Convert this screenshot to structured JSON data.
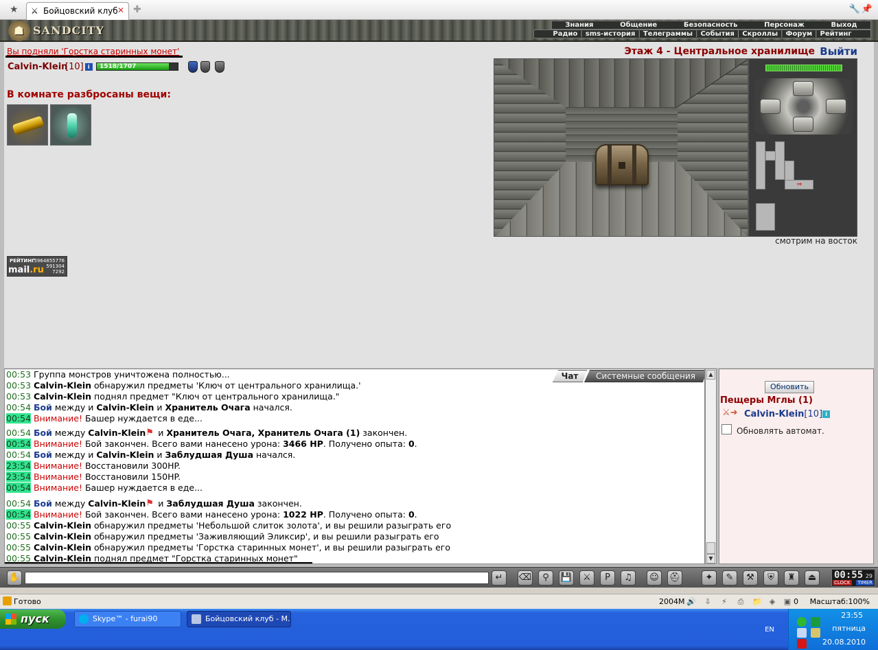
{
  "browser": {
    "tab_title": "Бойцовский клуб",
    "tab_favicon": "crossed-swords-icon"
  },
  "header": {
    "logo": "SANDCITY",
    "menu": [
      "Знания",
      "Общение",
      "Безопасность",
      "Персонаж",
      "Выход"
    ],
    "submenu": [
      "Радио",
      "sms-история",
      "Телеграммы",
      "События",
      "Скроллы",
      "Форум",
      "Рейтинг"
    ]
  },
  "main": {
    "pickup_message": "Вы подняли 'Горстка старинных монет'",
    "hero_name": "Calvin-Klein",
    "hero_level": "[10]",
    "hero_info_icon": "i",
    "hp_text": "1518/1707",
    "hp_fraction": 0.889,
    "items_header": "В комнате разбросаны вещи:",
    "floor_title": "Этаж 4 - Центральное хранилище",
    "exit_link": "Выйти",
    "look_direction": "смотрим на восток",
    "rating": {
      "label": "РЕЙТИНГ",
      "top": "5964855776",
      "brand": "mail",
      "brand_suffix": ".ru",
      "n1": "591304",
      "n2": "7292"
    }
  },
  "chat": {
    "tab_chat": "Чат",
    "tab_system": "Системные сообщения",
    "lines": [
      {
        "time": "00:53",
        "hl": false,
        "parts": [
          [
            "",
            "Группа монстров уничтожена полностью..."
          ]
        ]
      },
      {
        "time": "00:53",
        "hl": false,
        "parts": [
          [
            "nm",
            "Calvin-Klein"
          ],
          [
            "",
            " обнаружил предметы 'Ключ от центрального хранилища.'"
          ]
        ]
      },
      {
        "time": "00:53",
        "hl": false,
        "parts": [
          [
            "nm",
            "Calvin-Klein"
          ],
          [
            "",
            " поднял предмет \"Ключ от центрального хранилища.\""
          ]
        ]
      },
      {
        "time": "00:54",
        "hl": false,
        "parts": [
          [
            "boi",
            "Бой"
          ],
          [
            "",
            " между  и "
          ],
          [
            "nm",
            "Calvin-Klein"
          ],
          [
            "",
            " и "
          ],
          [
            "nm",
            "Хранитель Очага"
          ],
          [
            "",
            " начался."
          ]
        ]
      },
      {
        "time": "00:54",
        "hl": true,
        "parts": [
          [
            "att",
            "Внимание!"
          ],
          [
            "",
            " Башер нуждается в еде..."
          ]
        ]
      },
      {
        "time": "00:54",
        "hl": false,
        "parts": [
          [
            "boi",
            "Бой"
          ],
          [
            "",
            " между "
          ],
          [
            "nm",
            "Calvin-Klein"
          ],
          [
            "flag",
            ""
          ],
          [
            "",
            " и "
          ],
          [
            "nm",
            "Хранитель Очага, Хранитель Очага (1)"
          ],
          [
            "",
            " закончен."
          ]
        ]
      },
      {
        "time": "00:54",
        "hl": true,
        "parts": [
          [
            "att",
            "Внимание!"
          ],
          [
            "",
            " Бой закончен. Всего вами нанесено урона: "
          ],
          [
            "nm",
            "3466 HP"
          ],
          [
            "",
            ". Получено опыта: "
          ],
          [
            "nm",
            "0"
          ],
          [
            "",
            "."
          ]
        ]
      },
      {
        "time": "00:54",
        "hl": false,
        "parts": [
          [
            "boi",
            "Бой"
          ],
          [
            "",
            " между  и "
          ],
          [
            "nm",
            "Calvin-Klein"
          ],
          [
            "",
            " и "
          ],
          [
            "nm",
            "Заблудшая Душа"
          ],
          [
            "",
            " начался."
          ]
        ]
      },
      {
        "time": "23:54",
        "hl": true,
        "parts": [
          [
            "att",
            "Внимание!"
          ],
          [
            "",
            " Восстановили 300HP."
          ]
        ]
      },
      {
        "time": "23:54",
        "hl": true,
        "parts": [
          [
            "att",
            "Внимание!"
          ],
          [
            "",
            " Восстановили 150HP."
          ]
        ]
      },
      {
        "time": "00:54",
        "hl": true,
        "parts": [
          [
            "att",
            "Внимание!"
          ],
          [
            "",
            " Башер нуждается в еде..."
          ]
        ]
      },
      {
        "time": "00:54",
        "hl": false,
        "parts": [
          [
            "boi",
            "Бой"
          ],
          [
            "",
            " между "
          ],
          [
            "nm",
            "Calvin-Klein"
          ],
          [
            "flag",
            ""
          ],
          [
            "",
            " и "
          ],
          [
            "nm",
            "Заблудшая Душа"
          ],
          [
            "",
            " закончен."
          ]
        ]
      },
      {
        "time": "00:54",
        "hl": true,
        "parts": [
          [
            "att",
            "Внимание!"
          ],
          [
            "",
            " Бой закончен. Всего вами нанесено урона: "
          ],
          [
            "nm",
            "1022 HP"
          ],
          [
            "",
            ". Получено опыта: "
          ],
          [
            "nm",
            "0"
          ],
          [
            "",
            "."
          ]
        ]
      },
      {
        "time": "00:55",
        "hl": false,
        "parts": [
          [
            "nm",
            "Calvin-Klein"
          ],
          [
            "",
            " обнаружил предметы 'Небольшой слиток золота', и вы решили разыграть его"
          ]
        ]
      },
      {
        "time": "00:55",
        "hl": false,
        "parts": [
          [
            "nm",
            "Calvin-Klein"
          ],
          [
            "",
            " обнаружил предметы 'Заживляющий Эликсир', и вы решили разыграть его"
          ]
        ]
      },
      {
        "time": "00:55",
        "hl": false,
        "parts": [
          [
            "nm",
            "Calvin-Klein"
          ],
          [
            "",
            " обнаружил предметы 'Горстка старинных монет', и вы решили разыграть его"
          ]
        ]
      },
      {
        "time": "00:55",
        "hl": false,
        "parts": [
          [
            "nm",
            "Calvin-Klein"
          ],
          [
            "",
            " поднял предмет \"Горстка старинных монет\""
          ]
        ]
      }
    ]
  },
  "online": {
    "refresh_button": "Обновить",
    "room_name": "Пещеры Мглы (1)",
    "user_name": "Calvin-Klein",
    "user_level": "[10]",
    "user_info_icon": "i",
    "auto_refresh_label": "Обновлять автомат.",
    "auto_refresh_checked": false
  },
  "inputbar": {
    "clock_time": "00:55",
    "clock_seconds": "29",
    "clock_label": "CLOCK",
    "timer_label": "TIMER",
    "input_value": ""
  },
  "statusbar": {
    "status": "Готово",
    "memory": "2004M",
    "tab_count": "0",
    "zoom": "Масштаб:100%"
  },
  "taskbar": {
    "start": "пуск",
    "tasks": [
      "Skype™ - furai90",
      "Бойцовский клуб - М..."
    ],
    "lang": "EN",
    "time": "23:55",
    "day": "пятница",
    "date": "20.08.2010"
  },
  "colors": {
    "title_red": "#8b0000",
    "link_blue": "#1b3c8b",
    "highlight_green": "#32e38e",
    "attention_red": "#cc0000"
  }
}
